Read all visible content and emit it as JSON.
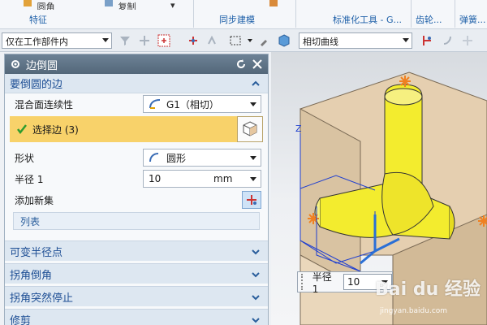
{
  "ribbon": {
    "top_items": [
      "圆角",
      "复制",
      "▾"
    ],
    "groups": [
      {
        "label": "特征"
      },
      {
        "label": "同步建模"
      },
      {
        "label": "标准化工具 - G..."
      },
      {
        "label": "齿轮..."
      },
      {
        "label": "弹簧..."
      }
    ]
  },
  "toolbar": {
    "scope_value": "仅在工作部件内",
    "curve_rule_value": "相切曲线"
  },
  "dialog": {
    "title": "边倒圆",
    "section_edges": "要倒圆的边",
    "blend_continuity_label": "混合面连续性",
    "blend_continuity_value": "G1（相切）",
    "select_edge_label": "选择边 (3)",
    "shape_label": "形状",
    "shape_value": "圆形",
    "radius_label": "半径 1",
    "radius_value": "10",
    "radius_unit": "mm",
    "add_new_set_label": "添加新集",
    "list_label": "列表",
    "collapsed_sections": [
      "可变半径点",
      "拐角倒角",
      "拐角突然停止",
      "修剪"
    ]
  },
  "viewport": {
    "axis_z": "Z"
  },
  "float_box": {
    "label": "半径 1",
    "value": "10"
  },
  "watermark": {
    "main": "Bai du 经验",
    "sub": "jingyan.baidu.com"
  },
  "colors": {
    "accent": "#1d4e94",
    "selection": "#f8d26a",
    "highlight_face": "#f3ec2e",
    "part_face": "#e7d3b6"
  }
}
